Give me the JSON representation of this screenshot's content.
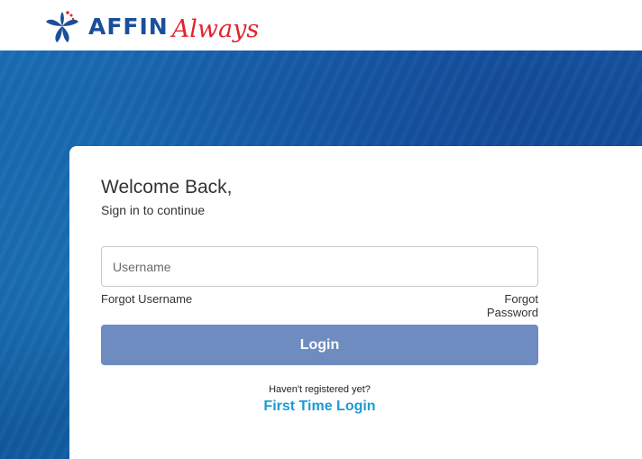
{
  "brand": {
    "name": "AFFIN",
    "tagline": "Always",
    "primary_color": "#1b4f9b",
    "accent_color": "#e0242f",
    "logo_icon": "affin-flower-logo-icon"
  },
  "login": {
    "heading": "Welcome Back,",
    "subheading": "Sign in to continue",
    "username_placeholder": "Username",
    "username_value": "",
    "forgot_username": "Forgot Username",
    "forgot_password": "Forgot Password",
    "login_label": "Login",
    "login_button_color": "#6e8cbf",
    "register_prompt": "Haven't registered yet?",
    "first_time_login": "First Time Login",
    "link_color": "#1d9bd3"
  }
}
